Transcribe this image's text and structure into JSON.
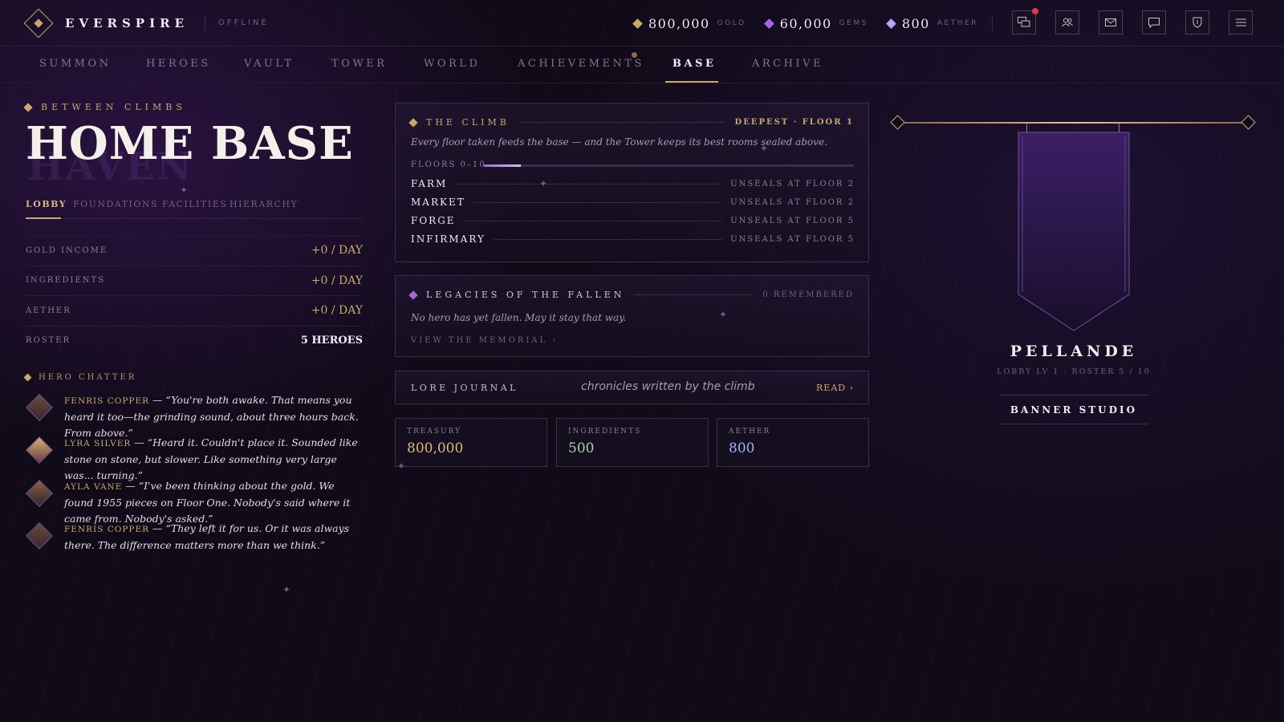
{
  "app": {
    "brand": "EVERSPIRE",
    "status": "OFFLINE"
  },
  "currencies": [
    {
      "value": "800,000",
      "label": "GOLD",
      "color": "#c9a86b",
      "icon": "gold-gem-icon"
    },
    {
      "value": "60,000",
      "label": "GEMS",
      "color": "#a865e0",
      "icon": "gem-icon"
    },
    {
      "value": "800",
      "label": "AETHER",
      "color": "#b6a7f5",
      "icon": "aether-icon"
    }
  ],
  "toolbar": {
    "icons": [
      "chat-bubbles-icon",
      "friends-icon",
      "mail-icon",
      "message-icon",
      "shield-icon",
      "menu-icon"
    ],
    "notification_color": "#e03a4a"
  },
  "nav": {
    "items": [
      "SUMMON",
      "HEROES",
      "VAULT",
      "TOWER",
      "WORLD",
      "ACHIEVEMENTS",
      "BASE",
      "ARCHIVE"
    ],
    "active": "BASE"
  },
  "header": {
    "eyebrow": "BETWEEN CLIMBS",
    "title": "HOME BASE",
    "title_shadow": "HAVEN"
  },
  "subtabs": {
    "items": [
      "LOBBY",
      "FOUNDATIONS",
      "FACILITIES",
      "HIERARCHY"
    ],
    "active": "LOBBY"
  },
  "stats": [
    {
      "label": "GOLD INCOME",
      "value": "+0 / DAY"
    },
    {
      "label": "INGREDIENTS",
      "value": "+0 / DAY"
    },
    {
      "label": "AETHER",
      "value": "+0 / DAY"
    },
    {
      "label": "ROSTER",
      "value": "5 HEROES"
    }
  ],
  "chatter": {
    "heading": "HERO CHATTER",
    "lines": [
      {
        "hero": "FENRIS COPPER",
        "sep": " — ",
        "quote": "“You're both awake. That means you heard it too—the grinding sound, about three hours back. From above.”"
      },
      {
        "hero": "LYRA SILVER",
        "sep": " — ",
        "quote": "“Heard it. Couldn't place it. Sounded like stone on stone, but slower. Like something very large was... turning.”"
      },
      {
        "hero": "AYLA VANE",
        "sep": " — ",
        "quote": "“I've been thinking about the gold. We found 1955 pieces on Floor One. Nobody's said where it came from. Nobody's asked.”"
      },
      {
        "hero": "FENRIS COPPER",
        "sep": " — ",
        "quote": "“They left it for us. Or it was always there. The difference matters more than we think.”"
      }
    ]
  },
  "climb": {
    "title": "THE CLIMB",
    "deepest": "DEEPEST · FLOOR 1",
    "description": "Every floor taken feeds the base — and the Tower keeps its best rooms sealed above.",
    "range_label": "FLOORS 0–10",
    "progress": 0.1,
    "facilities": [
      {
        "name": "FARM",
        "unseal": "UNSEALS AT FLOOR 2"
      },
      {
        "name": "MARKET",
        "unseal": "UNSEALS AT FLOOR 2"
      },
      {
        "name": "FORGE",
        "unseal": "UNSEALS AT FLOOR 5"
      },
      {
        "name": "INFIRMARY",
        "unseal": "UNSEALS AT FLOOR 5"
      }
    ]
  },
  "legacies": {
    "title": "LEGACIES OF THE FALLEN",
    "count": "0 REMEMBERED",
    "text": "No hero has yet fallen. May it stay that way.",
    "link": "VIEW THE MEMORIAL ›"
  },
  "lore": {
    "label": "LORE JOURNAL",
    "tagline": "chronicles written by the climb",
    "action": "READ ›"
  },
  "resources": [
    {
      "label": "TREASURY",
      "value": "800,000",
      "color": "#d9b881"
    },
    {
      "label": "INGREDIENTS",
      "value": "500",
      "color": "#a8d4a0"
    },
    {
      "label": "AETHER",
      "value": "800",
      "color": "#9fb4f5"
    }
  ],
  "banner": {
    "name": "PELLANDE",
    "subtitle": "LOBBY LV 1 · ROSTER 5 / 10",
    "studio_label": "BANNER STUDIO"
  }
}
